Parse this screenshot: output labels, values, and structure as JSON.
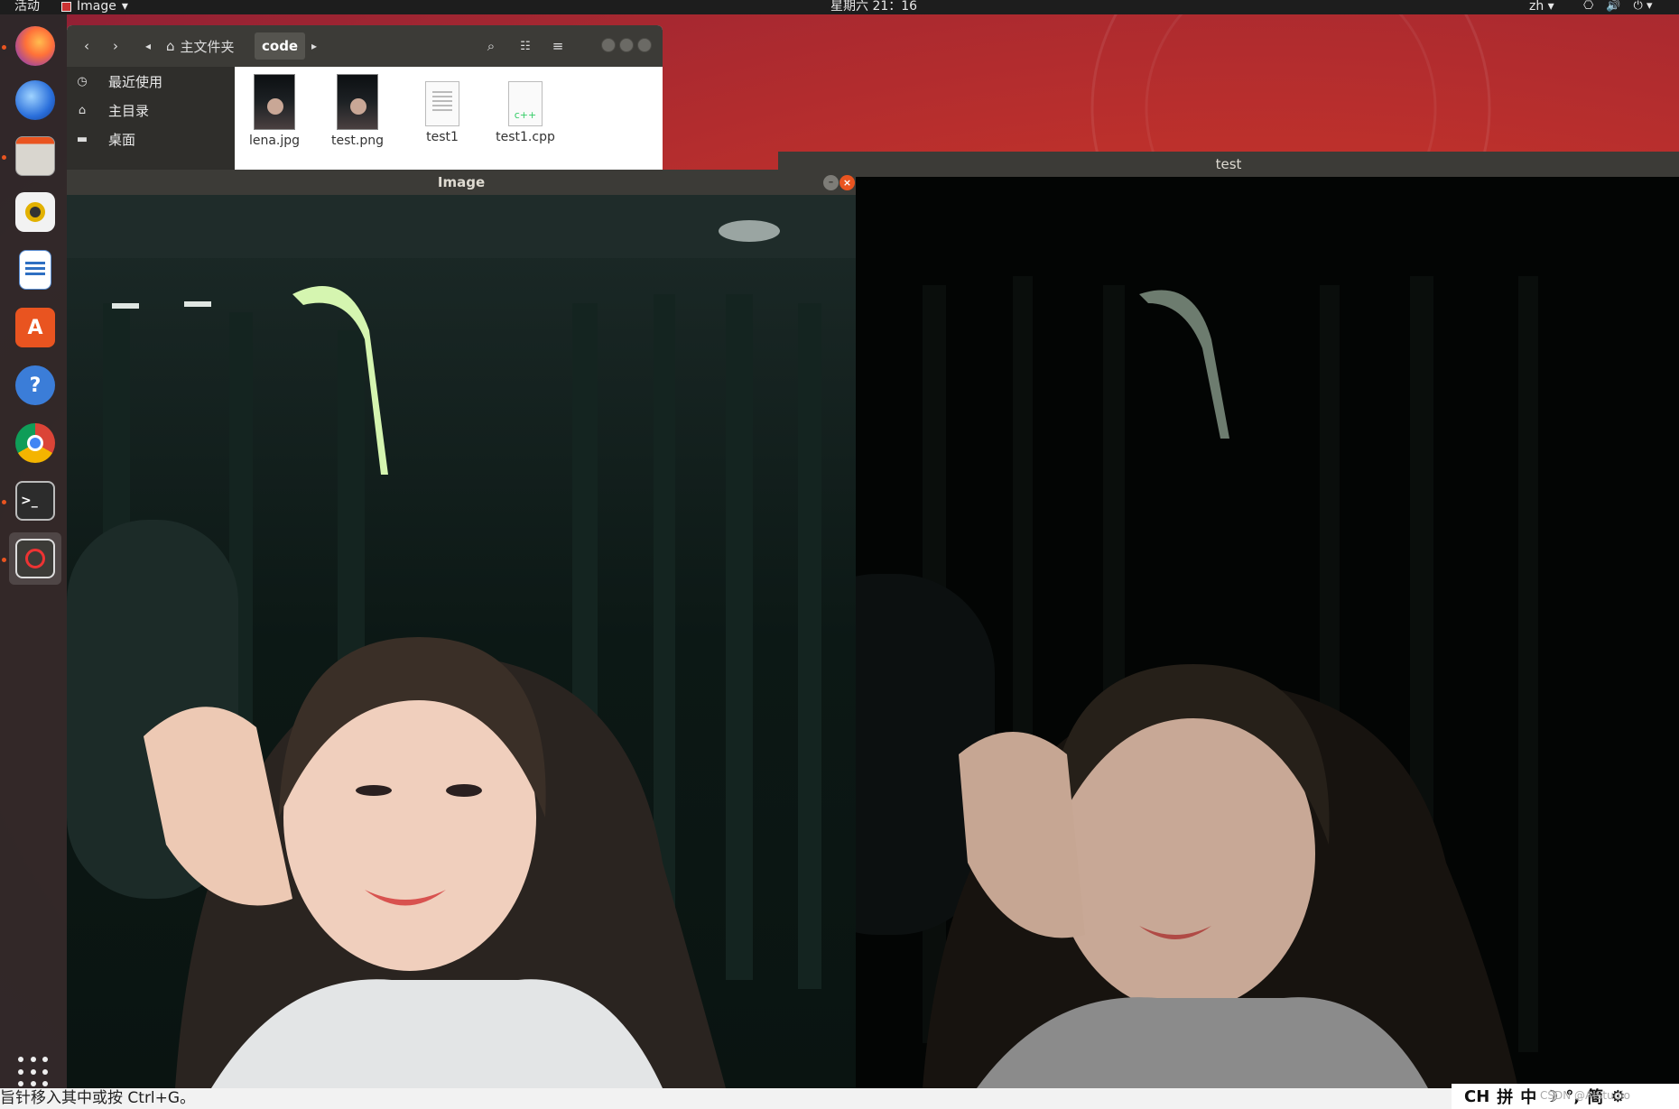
{
  "topbar": {
    "activities": "活动",
    "app_name": "Image",
    "clock": "星期六 21：16",
    "language": "zh"
  },
  "dock": {
    "items": [
      {
        "name": "firefox-icon"
      },
      {
        "name": "thunderbird-icon"
      },
      {
        "name": "files-icon"
      },
      {
        "name": "rhythmbox-icon"
      },
      {
        "name": "libreoffice-writer-icon"
      },
      {
        "name": "software-center-icon"
      },
      {
        "name": "help-icon"
      },
      {
        "name": "chrome-icon"
      },
      {
        "name": "terminal-icon"
      },
      {
        "name": "opencv-image-icon"
      }
    ]
  },
  "file_manager": {
    "breadcrumb_home": "主文件夹",
    "breadcrumb_current": "code",
    "sidebar": [
      {
        "label": "最近使用",
        "icon": "clock-icon"
      },
      {
        "label": "主目录",
        "icon": "home-icon"
      },
      {
        "label": "桌面",
        "icon": "folder-icon"
      }
    ],
    "files": [
      {
        "label": "lena.jpg",
        "kind": "photo"
      },
      {
        "label": "test.png",
        "kind": "photo"
      },
      {
        "label": "test1",
        "kind": "doc"
      },
      {
        "label": "test1.cpp",
        "kind": "cpp"
      }
    ]
  },
  "image_window": {
    "title": "Image"
  },
  "test_window": {
    "title": "test"
  },
  "statusline": {
    "text": "旨针移入其中或按 Ctrl+G。"
  },
  "ime": {
    "ch": "CH",
    "pin": "拼",
    "zhong": "中",
    "jian": "简",
    "watermark": "CSDN @AIStudio"
  },
  "colors": {
    "accent": "#e95420",
    "titlebar": "#3c3b37",
    "dock": "#282828"
  }
}
